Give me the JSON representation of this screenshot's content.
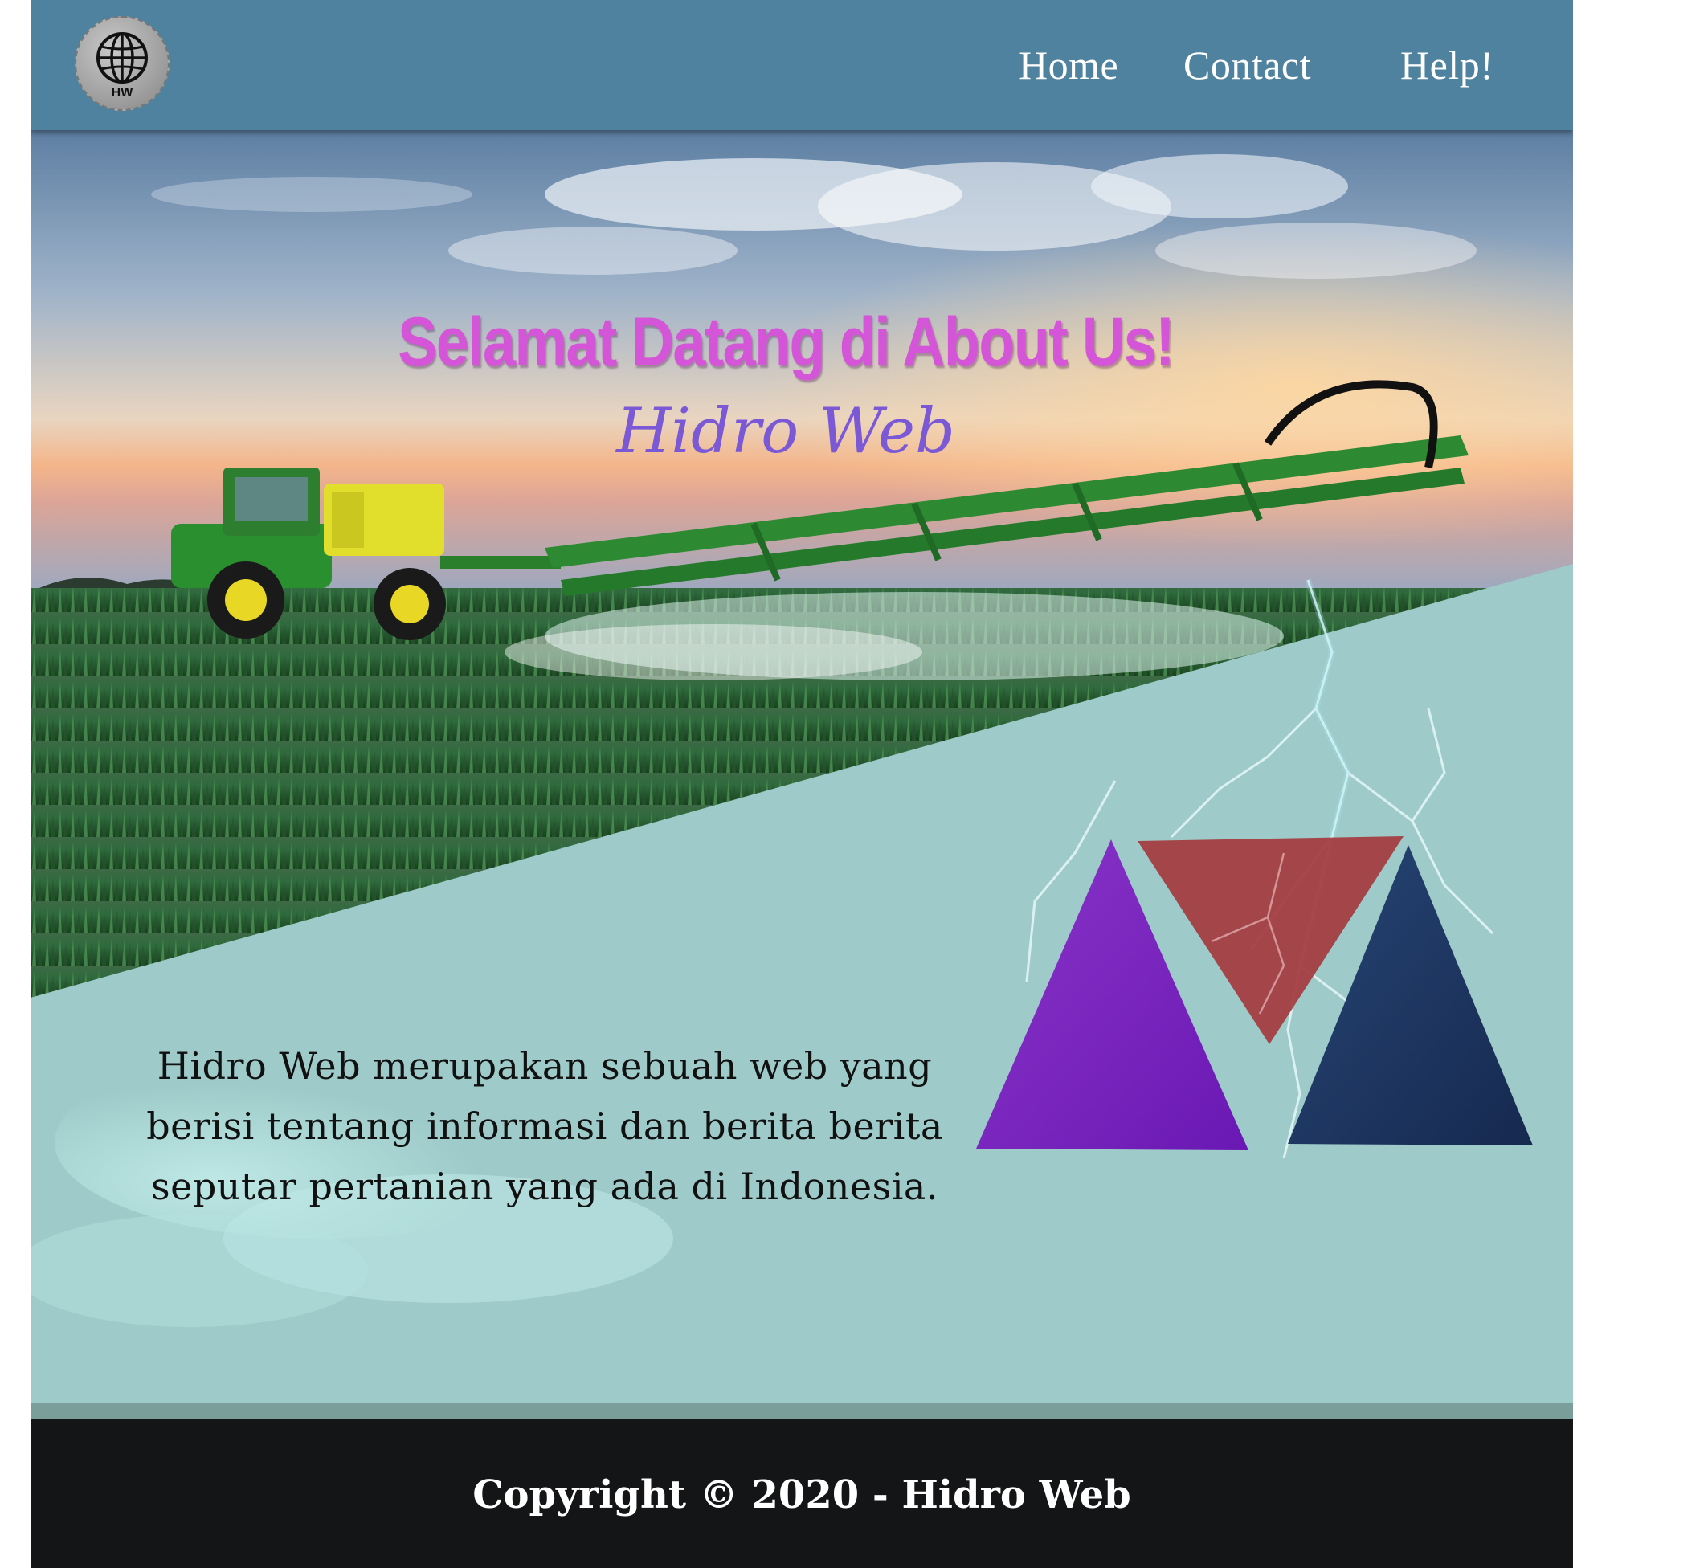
{
  "nav": {
    "logo_text": "HW",
    "links": [
      "Home",
      "Contact",
      "Help!"
    ]
  },
  "hero": {
    "title": "Selamat Datang di About Us!",
    "subtitle": "Hidro Web",
    "description": "Hidro Web merupakan sebuah web yang berisi tentang informasi dan berita berita seputar pertanian yang ada di Indonesia."
  },
  "footer": {
    "copyright": "Copyright © 2020 - Hidro Web"
  },
  "colors": {
    "navbar": "#4f829f",
    "title": "#d455d8",
    "subtitle": "#7a58d6",
    "panel": "#9ecbc9",
    "footer": "#141516",
    "triangle_purple": "#7a1fc0",
    "triangle_red": "#a53a3e",
    "triangle_navy": "#1c3258"
  }
}
